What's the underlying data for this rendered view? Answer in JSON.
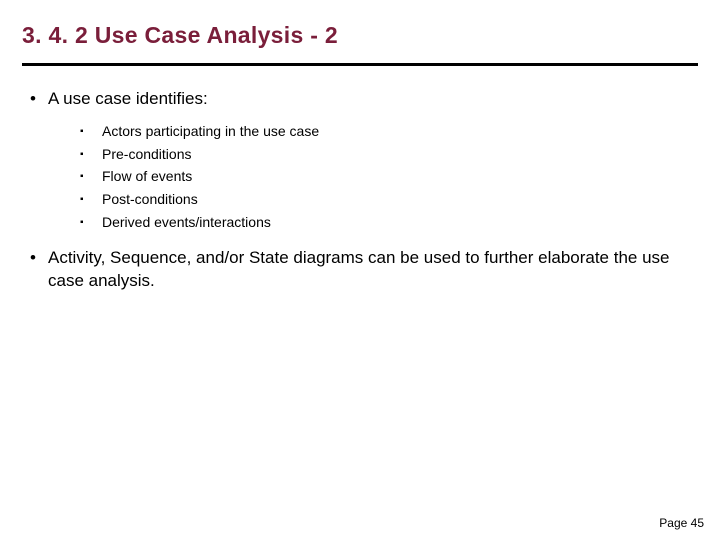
{
  "title": "3. 4. 2 Use Case Analysis - 2",
  "bullets": [
    {
      "text": "A use case identifies:",
      "sub": [
        "Actors participating in the use case",
        "Pre-conditions",
        "Flow of events",
        "Post-conditions",
        "Derived events/interactions"
      ]
    },
    {
      "text": "Activity, Sequence, and/or State diagrams can be used to further elaborate the use case analysis.",
      "sub": []
    }
  ],
  "footer": "Page 45"
}
